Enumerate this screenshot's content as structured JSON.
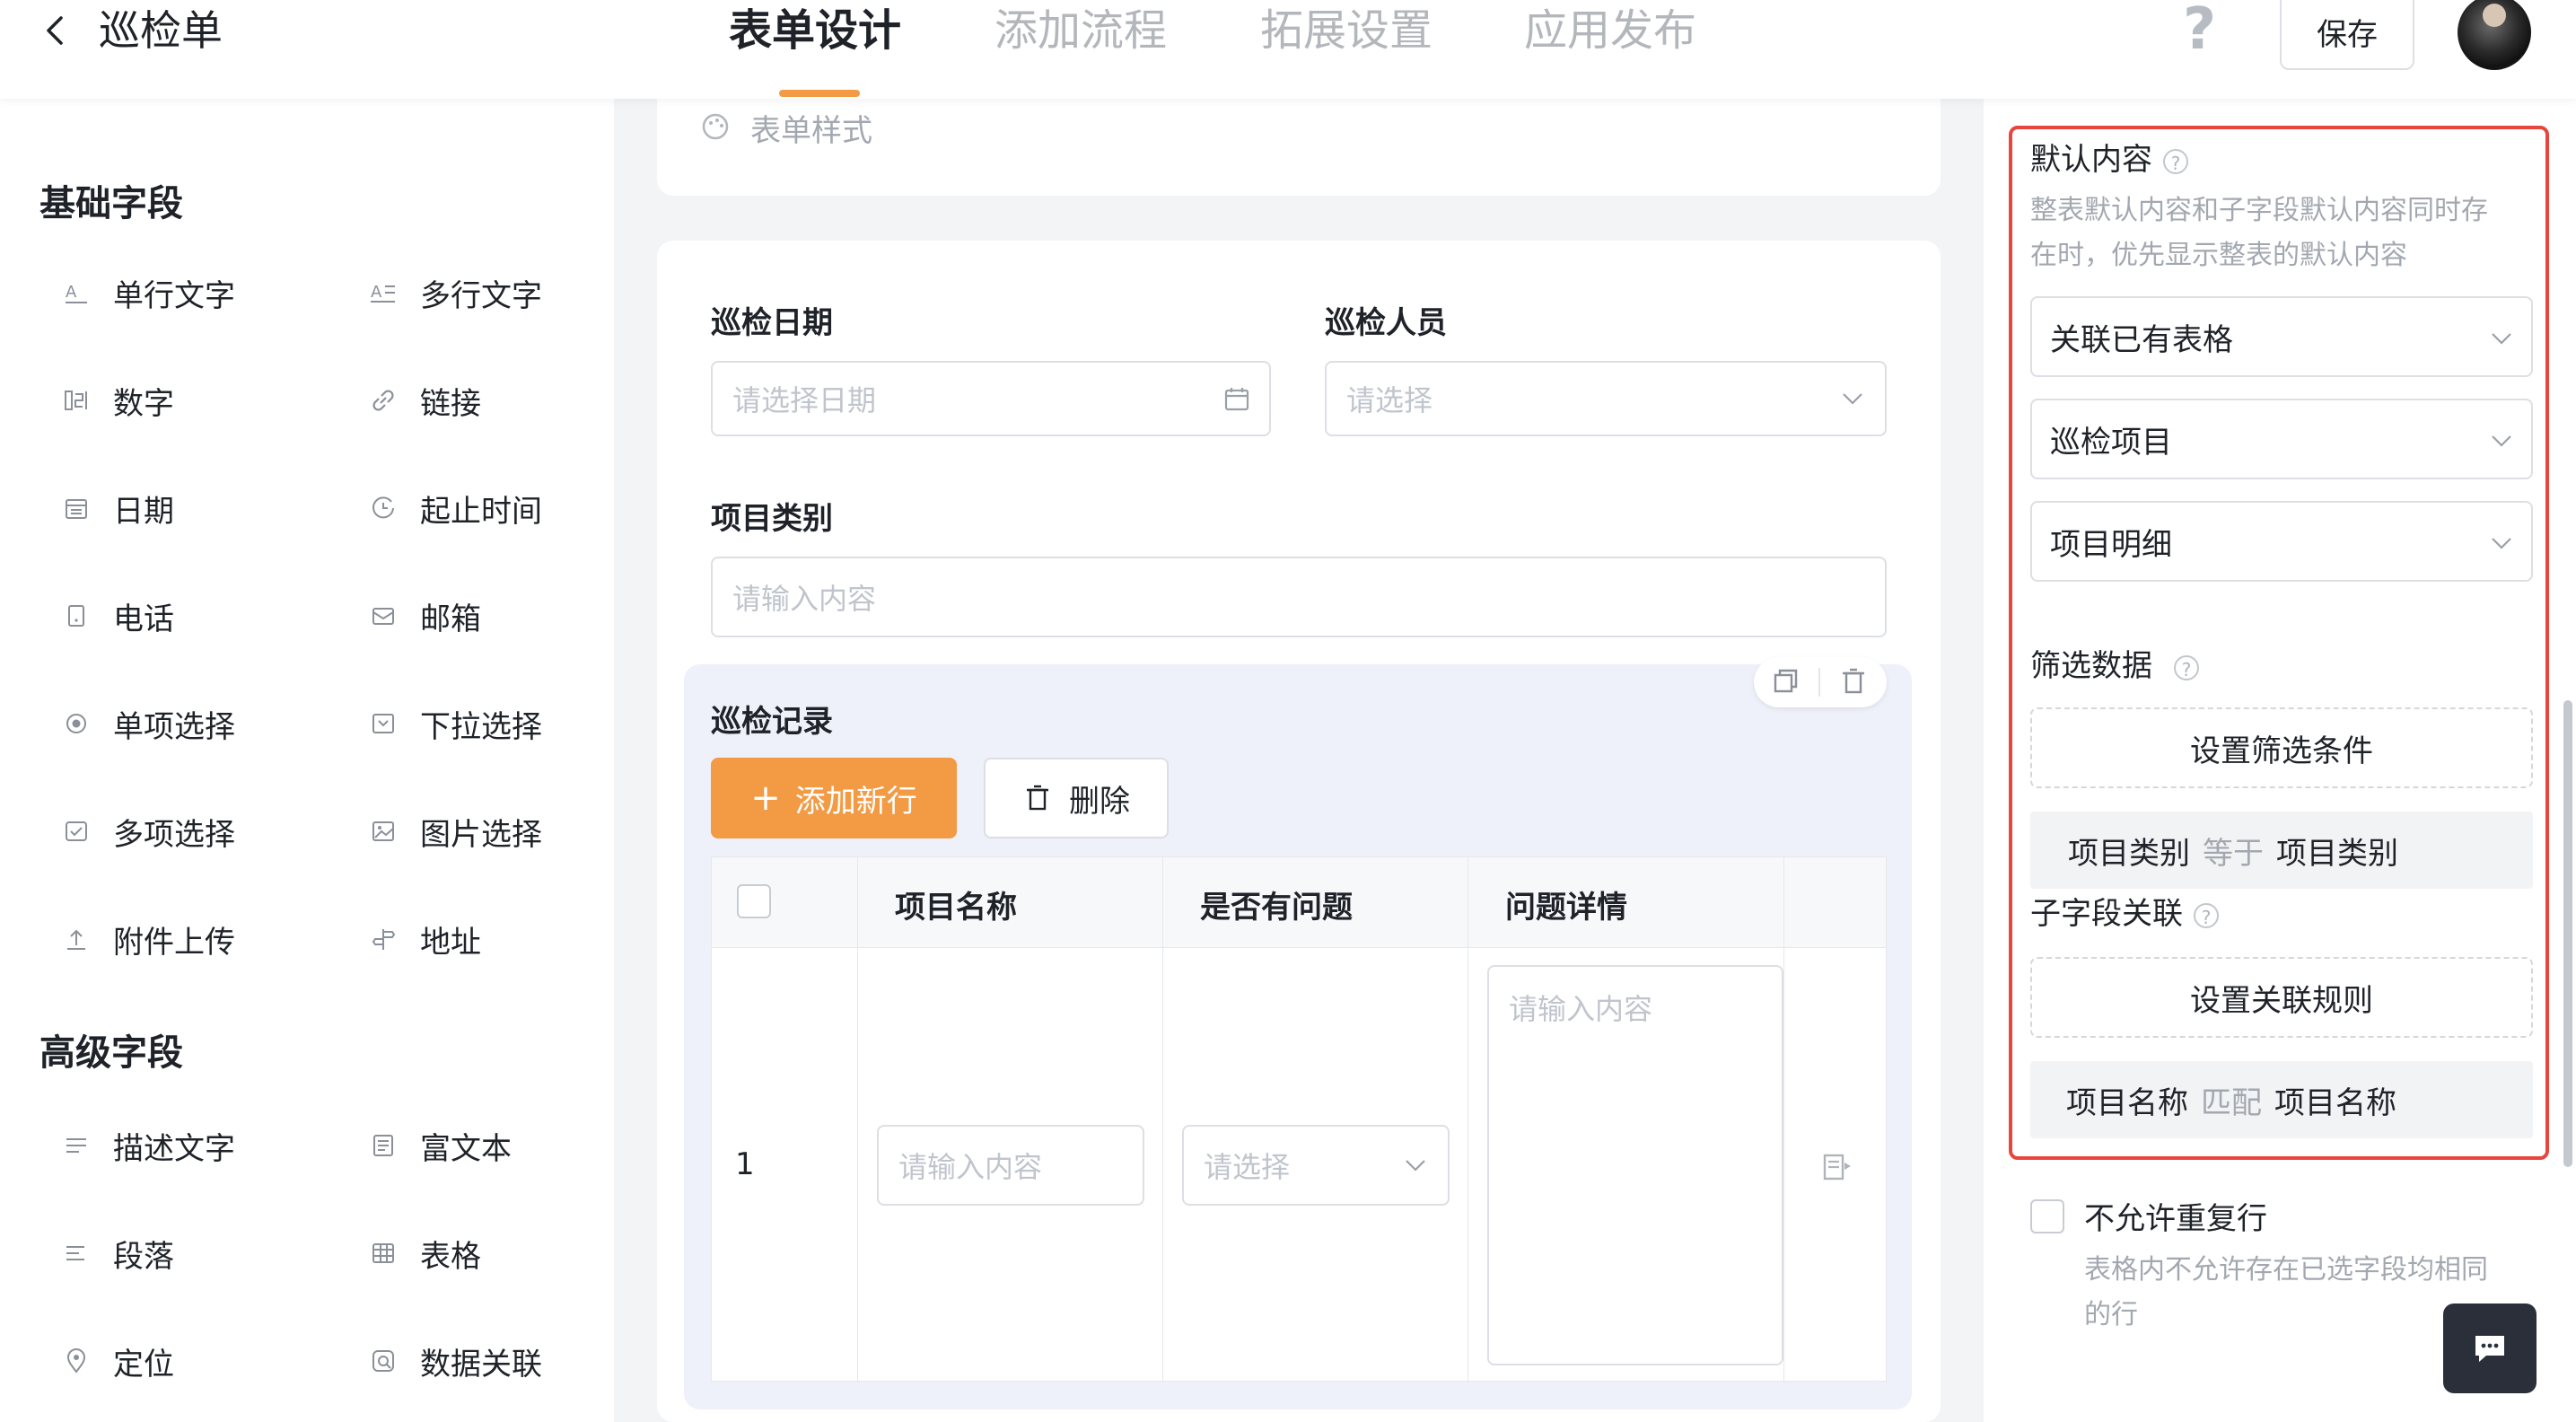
{
  "header": {
    "app_title": "巡检单",
    "tabs": [
      "表单设计",
      "添加流程",
      "拓展设置",
      "应用发布"
    ],
    "active_tab": 0,
    "help": "?",
    "save_label": "保存"
  },
  "left_panel": {
    "basic_title": "基础字段",
    "basic_fields": [
      {
        "label": "单行文字",
        "icon": "single-line-text-icon"
      },
      {
        "label": "多行文字",
        "icon": "multi-line-text-icon"
      },
      {
        "label": "数字",
        "icon": "number-icon"
      },
      {
        "label": "链接",
        "icon": "link-icon"
      },
      {
        "label": "日期",
        "icon": "calendar-icon"
      },
      {
        "label": "起止时间",
        "icon": "time-range-icon"
      },
      {
        "label": "电话",
        "icon": "phone-icon"
      },
      {
        "label": "邮箱",
        "icon": "mail-icon"
      },
      {
        "label": "单项选择",
        "icon": "radio-icon"
      },
      {
        "label": "下拉选择",
        "icon": "dropdown-icon"
      },
      {
        "label": "多项选择",
        "icon": "checkbox-icon"
      },
      {
        "label": "图片选择",
        "icon": "image-icon"
      },
      {
        "label": "附件上传",
        "icon": "upload-icon"
      },
      {
        "label": "地址",
        "icon": "address-icon"
      }
    ],
    "advanced_title": "高级字段",
    "advanced_fields": [
      {
        "label": "描述文字",
        "icon": "description-icon"
      },
      {
        "label": "富文本",
        "icon": "rich-text-icon"
      },
      {
        "label": "段落",
        "icon": "paragraph-icon"
      },
      {
        "label": "表格",
        "icon": "table-icon"
      },
      {
        "label": "定位",
        "icon": "location-icon"
      },
      {
        "label": "数据关联",
        "icon": "data-link-icon"
      }
    ]
  },
  "form": {
    "style_label": "表单样式",
    "date_label": "巡检日期",
    "date_placeholder": "请选择日期",
    "person_label": "巡检人员",
    "person_placeholder": "请选择",
    "category_label": "项目类别",
    "category_placeholder": "请输入内容",
    "subtable": {
      "title": "巡检记录",
      "add_row_label": "添加新行",
      "delete_label": "删除",
      "columns": [
        "项目名称",
        "是否有问题",
        "问题详情"
      ],
      "row_number": "1",
      "name_placeholder": "请输入内容",
      "select_placeholder": "请选择",
      "detail_placeholder": "请输入内容"
    }
  },
  "right_panel": {
    "default_title": "默认内容",
    "default_hint_1": "整表默认内容和子字段默认内容同时存",
    "default_hint_2": "在时，优先显示整表的默认内容",
    "selects": [
      "关联已有表格",
      "巡检项目",
      "项目明细"
    ],
    "filter_title": "筛选数据",
    "filter_button": "设置筛选条件",
    "filter_rule": {
      "left": "项目类别",
      "op": "等于",
      "right": "项目类别"
    },
    "link_title": "子字段关联",
    "link_button": "设置关联规则",
    "link_rule": {
      "left": "项目名称",
      "op": "匹配",
      "right": "项目名称"
    },
    "no_dup_label": "不允许重复行",
    "no_dup_hint_1": "表格内不允许存在已选字段均相同",
    "no_dup_hint_2": "的行"
  },
  "colors": {
    "accent": "#f29a44",
    "highlight_border": "#e8453c",
    "subtable_bg": "#eef0fa"
  }
}
